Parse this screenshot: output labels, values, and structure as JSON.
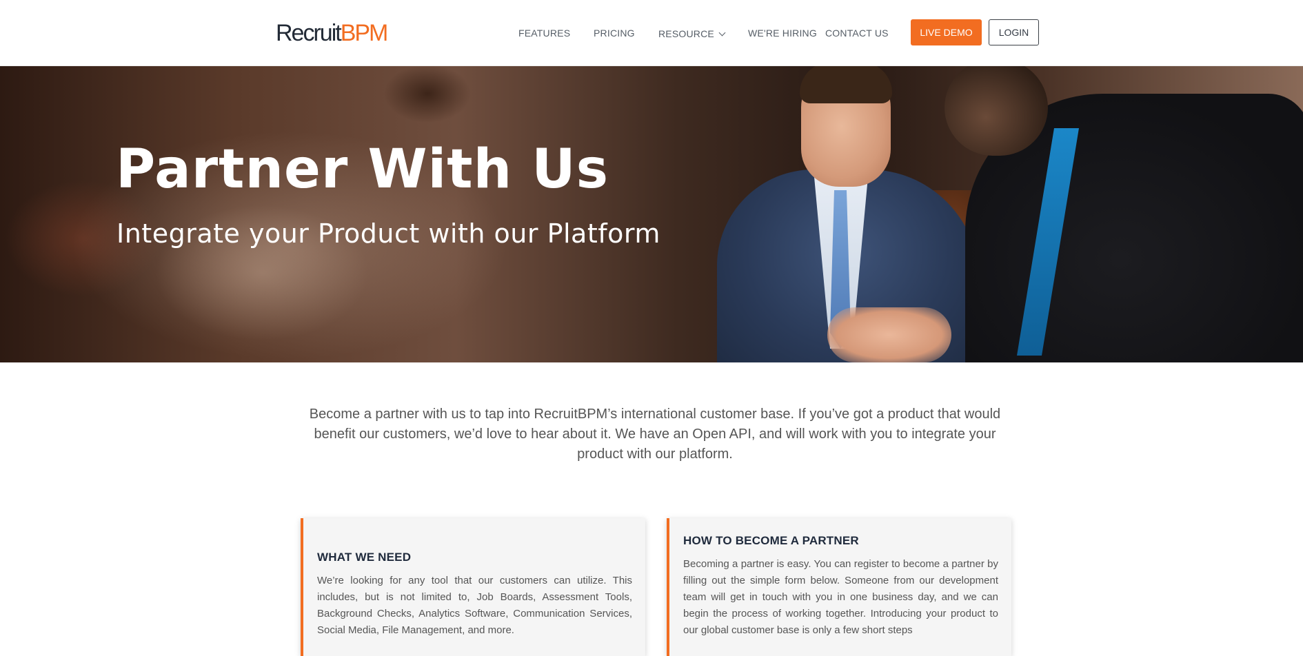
{
  "brand": {
    "logo_part1": "Recruit",
    "logo_part2": "BPM",
    "accent_color": "#f26d21"
  },
  "nav": {
    "features": "FEATURES",
    "pricing": "PRICING",
    "resource": "RESOURCE",
    "hiring": "WE'RE HIRING",
    "contact": "CONTACT US",
    "live_demo": "LIVE DEMO",
    "login": "LOGIN"
  },
  "hero": {
    "title": "Partner With Us",
    "subtitle": "Integrate your Product with our Platform"
  },
  "intro": "Become a partner with us to tap into RecruitBPM’s international customer base. If you’ve got a product that would benefit our customers, we’d love to hear about it. We have an Open API, and will work with you to integrate your product with our platform.",
  "cards": [
    {
      "title": "WHAT WE NEED",
      "body": "We’re looking for any tool that our customers can utilize. This includes, but is not limited to, Job Boards, Assessment Tools, Background Checks, Analytics Software, Communication Services, Social Media, File Management, and more."
    },
    {
      "title": "HOW TO BECOME A PARTNER",
      "body": "Becoming a partner is easy. You can register to become a partner by filling out the simple form below. Someone from our development team will get in touch with you in one business day, and we can begin the process of working together. Introducing your product to our global customer base is only a few short steps"
    }
  ]
}
